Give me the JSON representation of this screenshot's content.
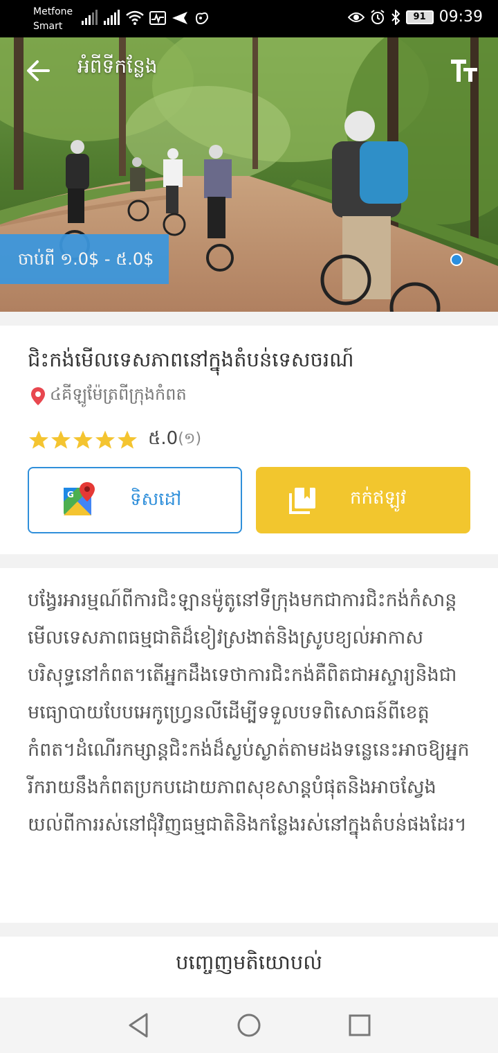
{
  "status_bar": {
    "carrier_line1": "Metfone",
    "carrier_line2": "Smart",
    "battery": "91",
    "time": "09:39"
  },
  "header": {
    "title": "អំពីទីកន្លែង"
  },
  "hero": {
    "price": "ចាប់ពី ១.0$ - ៥.0$"
  },
  "place": {
    "title": "ជិះកង់មើលទេសភាពនៅក្នុងតំបន់ទេសចរណ៍",
    "location": "៤គីឡូម៉ែត្រពីក្រុងកំពត",
    "rating_value": "៥.0",
    "rating_count": "(១)",
    "stars": 5,
    "direction_label": "ទិសដៅ",
    "book_label": "កក់ឥឡូវ"
  },
  "description": {
    "text": "បង្វែរអារម្មណ៍ពីការជិះឡានម៉ូតូនៅទីក្រុងមកជាការជិះកង់កំសាន្តមើលទេសភាពធម្មជាតិដ៏ខៀវស្រងាត់និងស្រូបខ្យល់អាកាសបរិសុទ្ធនៅកំពត។តើអ្នកដឹងទេថាការជិះកង់គឺពិតជាអស្ចារ្យនិងជាមធ្យោបាយបែបអេកូហ្វ្រេនលីដើម្បីទទួលបទពិសោធន៍ពីខេត្តកំពត។ដំណើរកម្សាន្តជិះកង់ដ៏ស្ងប់ស្ងាត់តាមដងទន្លេនេះអាចឱ្យអ្នករីករាយនឹងកំពតប្រកបដោយភាពសុខសាន្តបំផុតនិងអាចស្វែងយល់ពីការរស់នៅជុំវិញធម្មជាតិនិងកន្លែងរស់នៅក្នុងតំបន់ផងដែរ។"
  },
  "comments": {
    "title": "បញ្ចេញមតិយោបល់"
  },
  "colors": {
    "accent_blue": "#2f8fda",
    "book_yellow": "#f2c62e",
    "star_yellow": "#f4c430",
    "pin_red": "#e8474f"
  }
}
